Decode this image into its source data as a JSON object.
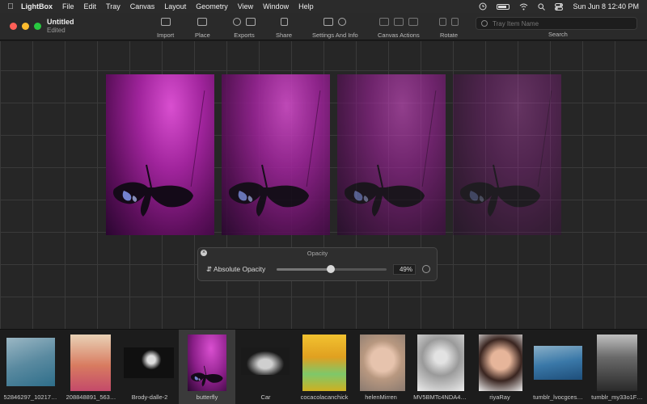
{
  "menubar": {
    "app_name": "LightBox",
    "menus": [
      "File",
      "Edit",
      "Tray",
      "Canvas",
      "Layout",
      "Geometry",
      "View",
      "Window",
      "Help"
    ],
    "clock": "Sun Jun 8  12:40 PM"
  },
  "window": {
    "title": "Untitled",
    "subtitle": "Edited"
  },
  "toolbar": {
    "import_label": "Import",
    "place_label": "Place",
    "exports_label": "Exports",
    "share_label": "Share",
    "settings_label": "Settings And Info",
    "canvas_actions_label": "Canvas Actions",
    "rotate_label": "Rotate",
    "search_label": "Search",
    "search_placeholder": "Tray Item Name"
  },
  "canvas": {
    "photo_opacities": [
      1.0,
      0.85,
      0.6,
      0.35
    ]
  },
  "opacity_panel": {
    "title": "Opacity",
    "mode": "Absolute Opacity",
    "value": 0.49,
    "value_label": "49%"
  },
  "tray": {
    "items": [
      {
        "label": "52846297_10217…",
        "selected": false
      },
      {
        "label": "208848891_563…",
        "selected": false
      },
      {
        "label": "Brody-dalle-2",
        "selected": false
      },
      {
        "label": "butterfly",
        "selected": true
      },
      {
        "label": "Car",
        "selected": false
      },
      {
        "label": "cocacolacanchick",
        "selected": false
      },
      {
        "label": "helenMirren",
        "selected": false
      },
      {
        "label": "MV5BMTc4NDA4…",
        "selected": false
      },
      {
        "label": "riyaRay",
        "selected": false
      },
      {
        "label": "tumblr_lvocgces…",
        "selected": false
      },
      {
        "label": "tumblr_my33o1F…",
        "selected": false
      }
    ]
  },
  "colors": {
    "close": "#fe5f57",
    "minimize": "#febc2e",
    "zoom": "#28c840",
    "photo_magenta": "#c63bc0"
  }
}
